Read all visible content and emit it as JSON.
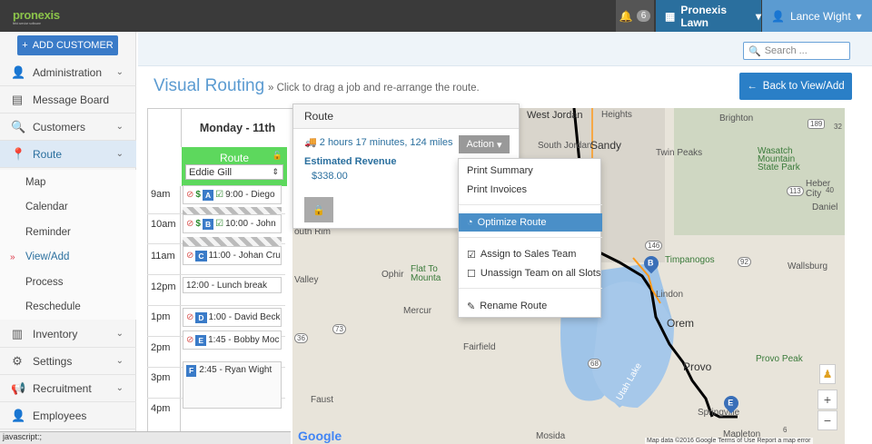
{
  "topbar": {
    "logo": "pronexis",
    "logo_tagline": "field service software",
    "notifications": "6",
    "company": "Pronexis Lawn",
    "user": "Lance Wight"
  },
  "sidebar": {
    "add_customer": "ADD CUSTOMER",
    "items": [
      {
        "label": "Administration"
      },
      {
        "label": "Message Board"
      },
      {
        "label": "Customers"
      },
      {
        "label": "Route"
      },
      {
        "label": "Inventory"
      },
      {
        "label": "Settings"
      },
      {
        "label": "Recruitment"
      },
      {
        "label": "Employees"
      }
    ],
    "route_sub": [
      "Map",
      "Calendar",
      "Reminder",
      "View/Add",
      "Process",
      "Reschedule"
    ]
  },
  "search": {
    "placeholder": "Search ..."
  },
  "page": {
    "title": "Visual Routing",
    "subtitle": "» Click to drag a job and re-arrange the route.",
    "back_button": "Back to View/Add"
  },
  "calendar": {
    "day": "Monday - 11th",
    "route_label": "Route",
    "route_employee": "Eddie Gill",
    "times": [
      "9am",
      "10am",
      "11am",
      "12pm",
      "1pm",
      "2pm",
      "3pm",
      "4pm"
    ],
    "appointments": [
      {
        "letter": "A",
        "text": "9:00 - Diego"
      },
      {
        "letter": "B",
        "text": "10:00 - John"
      },
      {
        "letter": "C",
        "text": "11:00 - Johan Cru"
      },
      {
        "letter": "D",
        "text": "1:00 - David Beck"
      },
      {
        "letter": "E",
        "text": "1:45 - Bobby Moc"
      },
      {
        "letter": "F",
        "text": "2:45 - Ryan Wight"
      }
    ],
    "lunch": "12:00 - Lunch break"
  },
  "route_popover": {
    "title": "Route",
    "duration": "2 hours 17 minutes, 124 miles",
    "revenue_label": "Estimated Revenue",
    "revenue": "$338.00",
    "action": "Action"
  },
  "action_menu": {
    "print_summary": "Print Summary",
    "print_invoices": "Print Invoices",
    "optimize": "Optimize Route",
    "assign": "Assign to Sales Team",
    "unassign": "Unassign Team on all Slots",
    "rename": "Rename Route"
  },
  "map": {
    "labels": {
      "west_jordan": "West Jordan",
      "south_jordan": "South Jordan",
      "sandy": "Sandy",
      "heights": "Heights",
      "brighton": "Brighton",
      "twin_peaks": "Twin Peaks",
      "wasatch": "Wasatch",
      "mountain": "Mountain",
      "state_park": "State Park",
      "heber": "Heber City",
      "daniel": "Daniel",
      "timpanogos": "Timpanogos",
      "wallsburg": "Wallsburg",
      "lindon": "Lindon",
      "orem": "Orem",
      "provo_peak": "Provo Peak",
      "provo": "Provo",
      "utah_lake": "Utah Lake",
      "ophir": "Ophir",
      "flat_top": "Flat To",
      "mountain2": "Mounta",
      "mercur": "Mercur",
      "fairfield": "Fairfield",
      "faust": "Faust",
      "valley": "Valley",
      "south_rim": "outh Rim",
      "mosida": "Mosida",
      "mapleton": "Mapleton",
      "springville": "Springville",
      "r189": "189",
      "r32": "32",
      "r113": "113",
      "r40": "40",
      "r146": "146",
      "r92": "92",
      "r36": "36",
      "r73": "73",
      "r68": "68",
      "r6": "6"
    },
    "pins": [
      "B",
      "E"
    ],
    "zoom_in": "+",
    "zoom_out": "−",
    "google": "Google",
    "attribution": "Map data ©2016 Google   Terms of Use   Report a map error"
  },
  "statusbar": "javascript:;"
}
